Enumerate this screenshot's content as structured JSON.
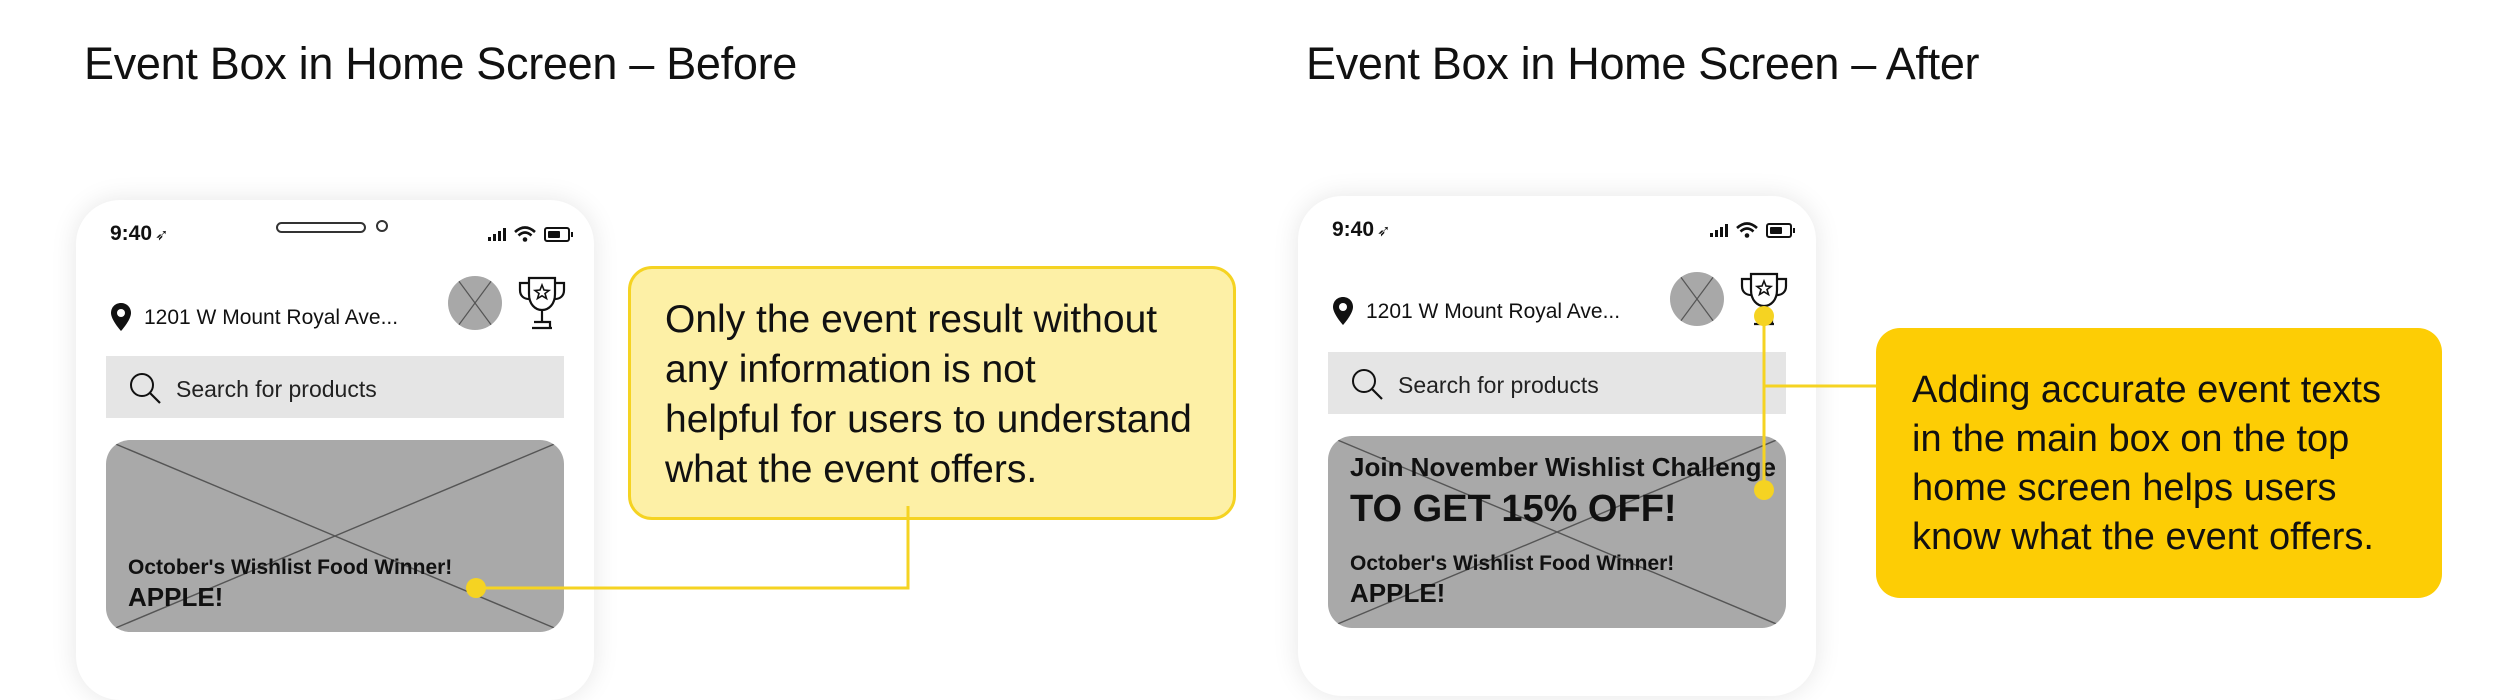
{
  "before": {
    "title": "Event Box in Home Screen – Before",
    "phone": {
      "time": "9:40",
      "address": "1201 W Mount Royal Ave...",
      "search_placeholder": "Search for products",
      "event": {
        "subtitle": "October's Wishlist Food Winner!",
        "result": "APPLE!"
      }
    },
    "callout": [
      "Only the event result without",
      "any information is not",
      "helpful for users to understand",
      "what the event offers."
    ]
  },
  "after": {
    "title": "Event Box in Home Screen – After",
    "phone": {
      "time": "9:40",
      "address": "1201 W Mount Royal Ave...",
      "search_placeholder": "Search for products",
      "event": {
        "headline": "Join November Wishlist Challenge",
        "offer": "TO GET 15% OFF!",
        "subtitle": "October's Wishlist Food Winner!",
        "result": "APPLE!"
      }
    },
    "callout": [
      "Adding accurate event texts",
      "in the main box on the top",
      "home screen helps users",
      "know what the event offers."
    ]
  },
  "icons": [
    "location-arrow-icon",
    "cellular-signal-icon",
    "wifi-icon",
    "battery-icon",
    "map-pin-icon",
    "avatar-placeholder",
    "trophy-star-icon",
    "search-icon"
  ],
  "colors": {
    "callout_before_fill": "#fdf0a6",
    "callout_before_border": "#f5d322",
    "callout_after_fill": "#fdcd05",
    "connector": "#f5d322",
    "placeholder_gray": "#a9a9a9",
    "search_bg": "#e5e5e5"
  }
}
